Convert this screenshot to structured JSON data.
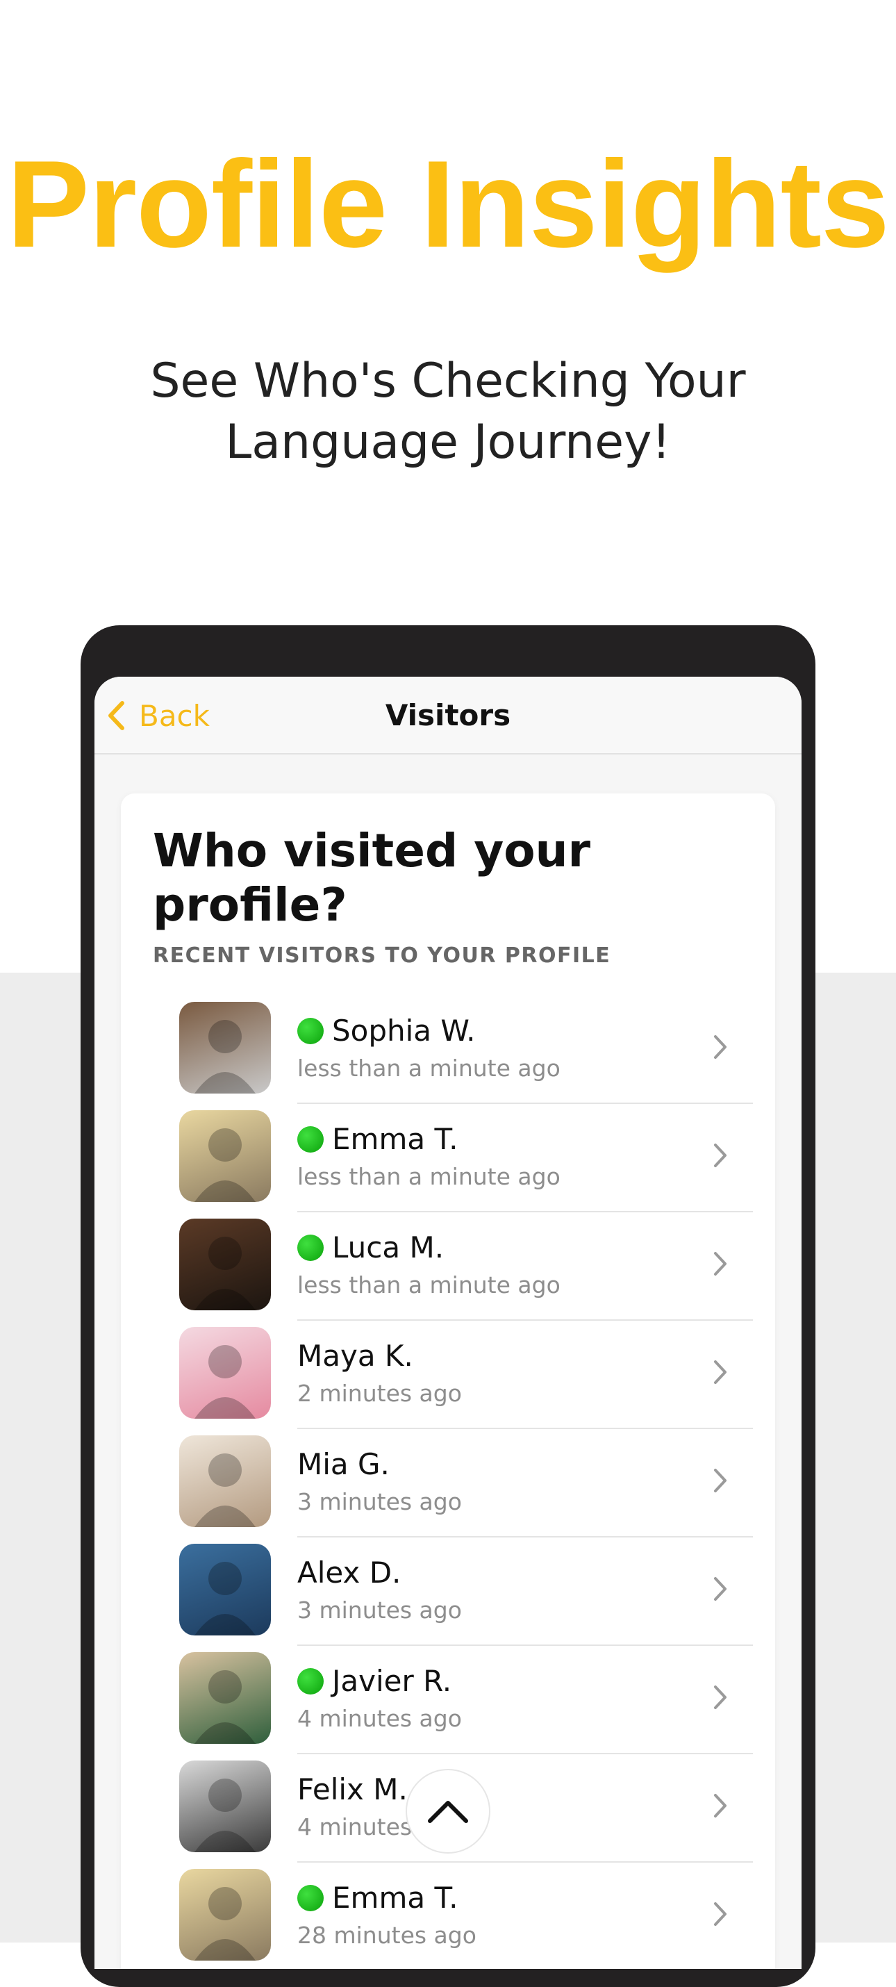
{
  "promo": {
    "headline": "Profile Insights",
    "subtitle_line1": "See Who's Checking Your",
    "subtitle_line2": "Language Journey!"
  },
  "navbar": {
    "back_label": "Back",
    "title": "Visitors"
  },
  "card": {
    "title": "Who visited your profile?",
    "subtitle": "RECENT VISITORS TO YOUR PROFILE"
  },
  "visitors": [
    {
      "name": "Sophia W.",
      "time": "less than a minute ago",
      "online": true
    },
    {
      "name": "Emma T.",
      "time": "less than a minute ago",
      "online": true
    },
    {
      "name": "Luca M.",
      "time": "less than a minute ago",
      "online": true
    },
    {
      "name": "Maya K.",
      "time": "2 minutes ago",
      "online": false
    },
    {
      "name": "Mia G.",
      "time": "3 minutes ago",
      "online": false
    },
    {
      "name": "Alex D.",
      "time": "3 minutes ago",
      "online": false
    },
    {
      "name": "Javier R.",
      "time": "4 minutes ago",
      "online": true
    },
    {
      "name": "Felix M.",
      "time": "4 minutes ago",
      "online": false
    },
    {
      "name": "Emma T.",
      "time": "28 minutes ago",
      "online": true
    }
  ],
  "colors": {
    "accent": "#fbbf14",
    "online": "#10b510",
    "phone_frame": "#232122",
    "background_gray": "#ededed"
  },
  "icons": {
    "back": "chevron-left-icon",
    "row_action": "chevron-right-icon",
    "scroll_top": "chevron-up-icon",
    "status": "online-dot-icon"
  }
}
